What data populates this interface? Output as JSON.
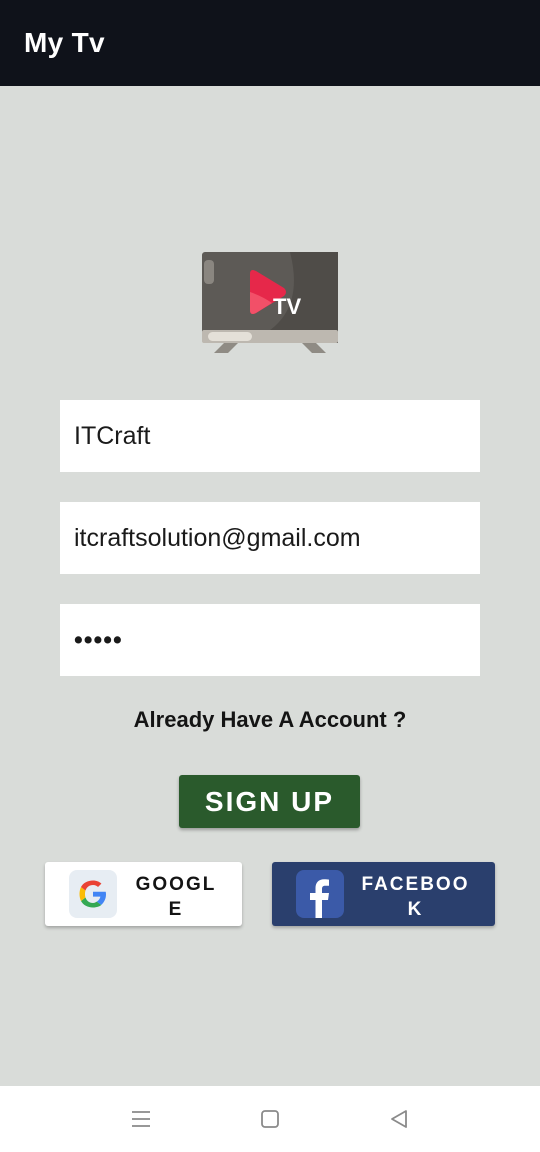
{
  "app_bar": {
    "title": "My Tv"
  },
  "logo": {
    "icon": "tv-logo-icon",
    "text": "TV"
  },
  "form": {
    "name_value": "ITCraft",
    "email_value": "itcraftsolution@gmail.com",
    "password_mask": "•••••",
    "account_link": "Already Have A Account ?",
    "signup_label": "SIGN UP"
  },
  "social": {
    "google_label": "GOOGLE",
    "facebook_label": "FACEBOOK"
  },
  "nav": {
    "items": [
      "menu-icon",
      "home-icon",
      "back-icon"
    ]
  },
  "colors": {
    "app_bar": "#0f121a",
    "background": "#d9dcd9",
    "signup_button": "#2a5a2c",
    "facebook_button": "#2a3f6d"
  }
}
